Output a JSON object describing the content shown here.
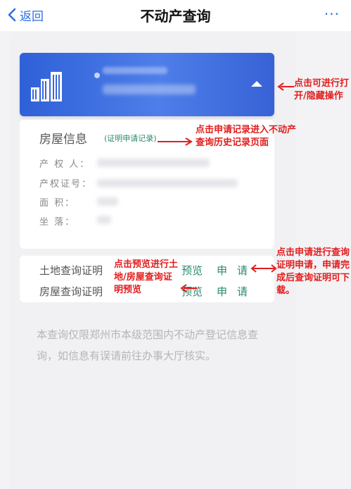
{
  "nav": {
    "back_label": "返回",
    "title": "不动产查询",
    "more": "···"
  },
  "info": {
    "title": "房屋信息",
    "record_link": "(证明申请记录)",
    "fields": [
      "产 权 人：",
      "产权证号：",
      "面    积：",
      "坐    落："
    ]
  },
  "proofs": [
    {
      "name": "土地查询证明",
      "preview": "预览",
      "apply": "申请"
    },
    {
      "name": "房屋查询证明",
      "preview": "预览",
      "apply": "申请"
    }
  ],
  "note": "本查询仅限郑州市本级范围内不动产登记信息查询，如信息有误请前往办事大厅核实。",
  "annotations": {
    "toggle": "点击可进行打开/隐藏操作",
    "record": "点击申请记录进入不动产查询历史记录页面",
    "preview": "点击预览进行土地/房屋查询证明预览",
    "apply": "点击申请进行查询证明申请，申请完成后查询证明可下载。"
  },
  "colors": {
    "accent": "#2b6fe0",
    "card_blue": "#3a68dc",
    "link_green": "#2a8a70",
    "annotation_red": "#e21d1d"
  }
}
